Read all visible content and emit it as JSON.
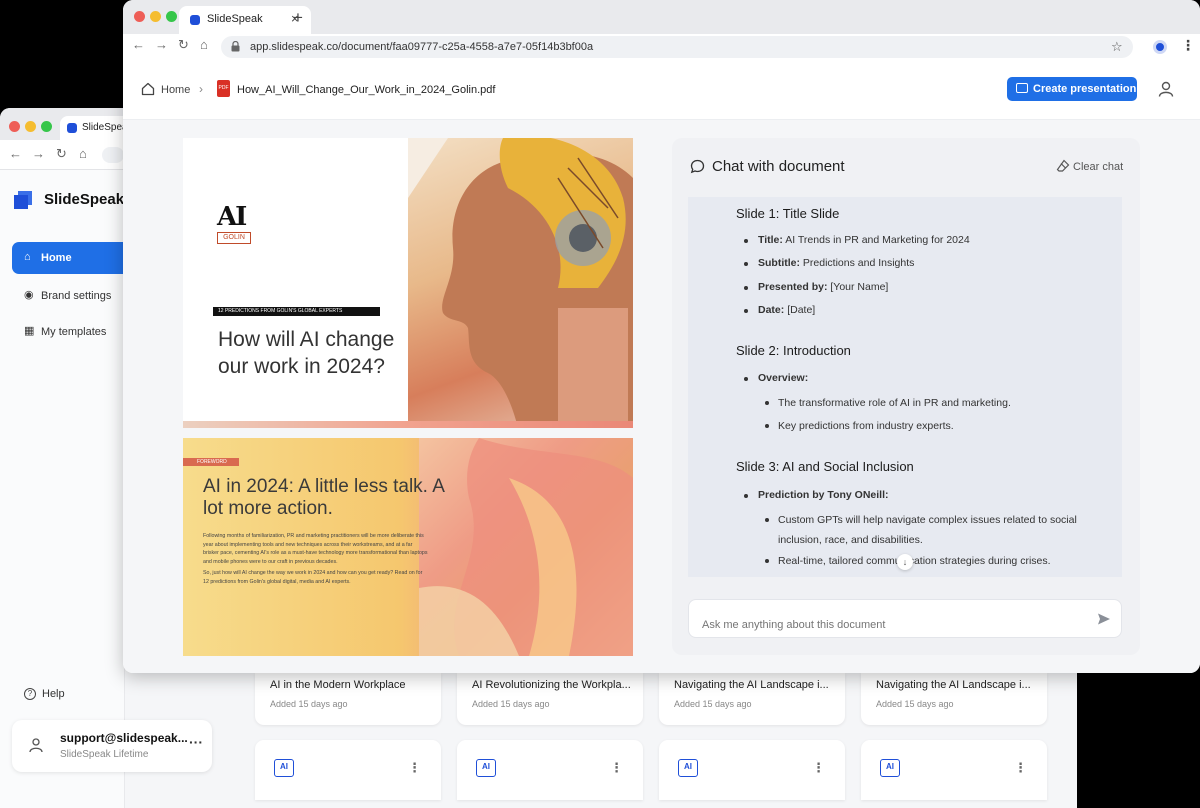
{
  "back_window": {
    "tab_title": "SlideSpeak",
    "brand_name": "SlideSpeak",
    "nav": [
      {
        "label": "Home",
        "icon": "home-icon"
      },
      {
        "label": "Brand settings",
        "icon": "palette-icon"
      },
      {
        "label": "My templates",
        "icon": "templates-icon"
      }
    ],
    "help_label": "Help",
    "user": {
      "email": "support@slidespeak...",
      "plan": "SlideSpeak Lifetime"
    },
    "recent_docs": [
      {
        "title": "AI in the Modern Workplace",
        "added": "Added 15 days ago"
      },
      {
        "title": "AI Revolutionizing the Workpla...",
        "added": "Added 15 days ago"
      },
      {
        "title": "Navigating the AI Landscape i...",
        "added": "Added 15 days ago"
      },
      {
        "title": "Navigating the AI Landscape i...",
        "added": "Added 15 days ago"
      }
    ],
    "template_card_badge": "AI"
  },
  "front_window": {
    "tab_title": "SlideSpeak",
    "url": "app.slidespeak.co/document/faa09777-c25a-4558-a7e7-05f14b3bf00a",
    "breadcrumb": {
      "home": "Home",
      "file": "How_AI_Will_Change_Our_Work_in_2024_Golin.pdf",
      "file_badge": "PDF"
    },
    "create_button": "Create presentation"
  },
  "document_preview": {
    "page1": {
      "logo_mark": "AI",
      "logo_sub": "GOLIN",
      "kicker": "12 PREDICTIONS FROM GOLIN'S GLOBAL EXPERTS",
      "headline": "How will AI change our work in 2024?"
    },
    "page2": {
      "kicker": "FOREWORD",
      "headline": "AI in 2024: A little less talk. A lot more action.",
      "body_1": "Following months of familiarization, PR and marketing practitioners will be more deliberate this year about implementing tools and new techniques across their workstreams, and at a far brisker pace, cementing AI's role as a must-have technology more transformational than laptops and mobile phones were to our craft in previous decades.",
      "body_2": "So, just how will AI change the way we work in 2024 and how can you get ready? Read on for 12 predictions from Golin's global digital, media and AI experts."
    }
  },
  "chat": {
    "title": "Chat with document",
    "clear_label": "Clear chat",
    "slides": [
      {
        "heading": "Slide 1: Title Slide",
        "bullets": [
          {
            "label": "Title:",
            "text": "AI Trends in PR and Marketing for 2024"
          },
          {
            "label": "Subtitle:",
            "text": "Predictions and Insights"
          },
          {
            "label": "Presented by:",
            "text": "[Your Name]"
          },
          {
            "label": "Date:",
            "text": "[Date]"
          }
        ]
      },
      {
        "heading": "Slide 2: Introduction",
        "bullets": [
          {
            "label": "Overview:",
            "text": ""
          }
        ],
        "sub_bullets": [
          "The transformative role of AI in PR and marketing.",
          "Key predictions from industry experts."
        ]
      },
      {
        "heading": "Slide 3: AI and Social Inclusion",
        "bullets": [
          {
            "label": "Prediction by Tony ONeill:",
            "text": ""
          }
        ],
        "sub_bullets": [
          "Custom GPTs will help navigate complex issues related to social inclusion, race, and disabilities.",
          "Real-time, tailored communication strategies during crises."
        ]
      }
    ],
    "input_placeholder": "Ask me anything about this document"
  },
  "colors": {
    "accent": "#1f6fe6",
    "brand": "#1f4fd8",
    "pdf": "#d93025"
  }
}
